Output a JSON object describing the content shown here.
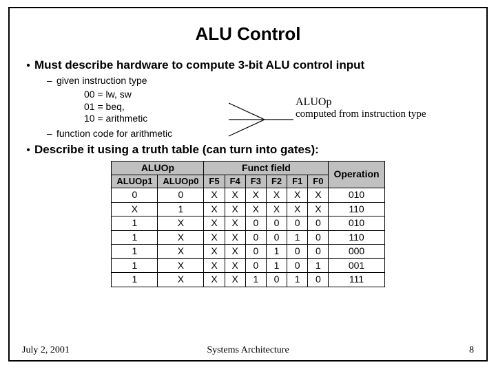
{
  "title": "ALU Control",
  "bullets": {
    "b1": "Must describe hardware to compute 3-bit ALU control input",
    "s1": "given instruction type",
    "i1": "00 = lw, sw",
    "i2": "01 = beq,",
    "i3": "10 = arithmetic",
    "s2": "function code for arithmetic",
    "b2": "Describe it using a truth table (can turn into gates):"
  },
  "note": {
    "l1": "ALUOp",
    "l2": "computed from instruction type"
  },
  "chart_data": {
    "type": "table",
    "title": "ALU Control truth table",
    "headers_top": [
      "ALUOp",
      "Funct field",
      "Operation"
    ],
    "headers_sub": [
      "ALUOp1",
      "ALUOp0",
      "F5",
      "F4",
      "F3",
      "F2",
      "F1",
      "F0"
    ],
    "rows": [
      [
        "0",
        "0",
        "X",
        "X",
        "X",
        "X",
        "X",
        "X",
        "010"
      ],
      [
        "X",
        "1",
        "X",
        "X",
        "X",
        "X",
        "X",
        "X",
        "110"
      ],
      [
        "1",
        "X",
        "X",
        "X",
        "0",
        "0",
        "0",
        "0",
        "010"
      ],
      [
        "1",
        "X",
        "X",
        "X",
        "0",
        "0",
        "1",
        "0",
        "110"
      ],
      [
        "1",
        "X",
        "X",
        "X",
        "0",
        "1",
        "0",
        "0",
        "000"
      ],
      [
        "1",
        "X",
        "X",
        "X",
        "0",
        "1",
        "0",
        "1",
        "001"
      ],
      [
        "1",
        "X",
        "X",
        "X",
        "1",
        "0",
        "1",
        "0",
        "111"
      ]
    ]
  },
  "footer": {
    "date": "July 2, 2001",
    "center": "Systems Architecture",
    "page": "8"
  }
}
